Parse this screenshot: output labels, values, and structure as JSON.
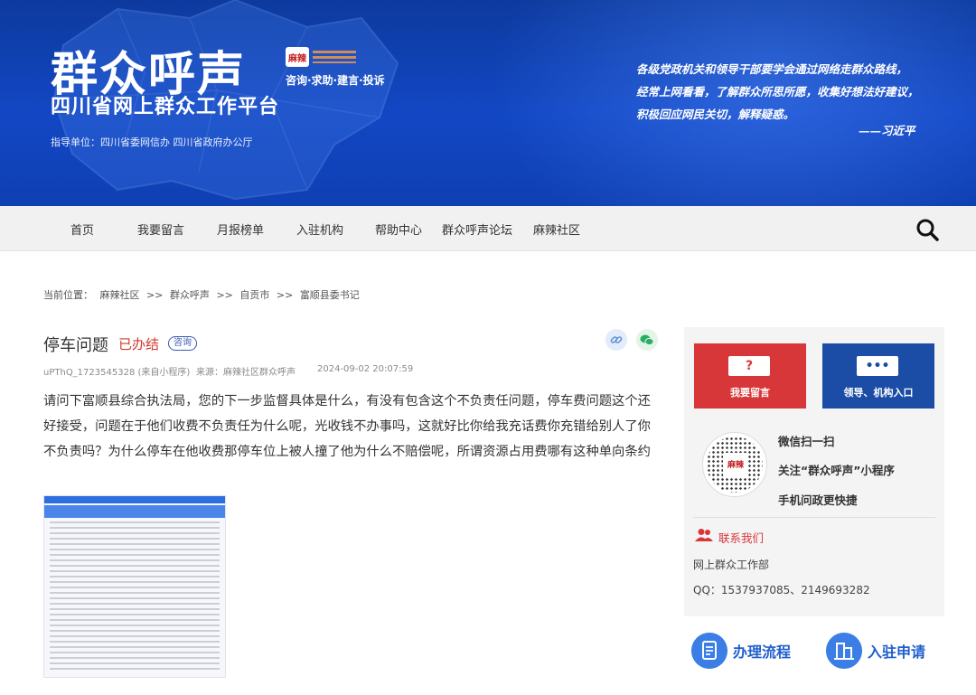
{
  "header": {
    "title": "群众呼声",
    "subtitle": "四川省网上群众工作平台",
    "guide": "指导单位：四川省委网信办 四川省政府办公厅",
    "mala_logo": "麻辣",
    "tags": "咨询·求助·建言·投诉",
    "quote_lines": [
      "各级党政机关和领导干部要学会通过网络走群众路线，",
      "经常上网看看，了解群众所思所愿，收集好想法好建议，",
      "积极回应网民关切，解释疑惑。"
    ],
    "quote_author": "——习近平"
  },
  "nav": {
    "items": [
      "首页",
      "我要留言",
      "月报榜单",
      "入驻机构",
      "帮助中心",
      "群众呼声论坛",
      "麻辣社区"
    ]
  },
  "breadcrumb": {
    "prefix": "当前位置：",
    "items": [
      "麻辣社区",
      "群众呼声",
      "自贡市",
      "富顺县委书记"
    ],
    "separator": ">>"
  },
  "article": {
    "title": "停车问题",
    "status": "已办结",
    "tag": "咨询",
    "author": "uPThQ_1723545328 (来自小程序)",
    "source": "来源：麻辣社区群众呼声",
    "time": "2024-09-02 20:07:59",
    "body": "请问下富顺县综合执法局，您的下一步监督具体是什么，有没有包含这个不负责任问题，停车费问题这个还好接受，问题在于他们收费不负责任为什么呢，光收钱不办事吗，这就好比你给我充话费你充错给别人了你不负责吗？为什么停车在他收费那停车位上被人撞了他为什么不赔偿呢，所谓资源占用费哪有这种单向条约"
  },
  "sidebar": {
    "leave_button": "我要留言",
    "leave_icon": "?",
    "org_button": "领导、机构入口",
    "org_icon": "•••",
    "qr_logo": "麻辣",
    "qr_lines": [
      "微信扫一扫",
      "关注“群众呼声”小程序",
      "手机问政更快捷"
    ],
    "contact_title": "联系我们",
    "contact_dept": "网上群众工作部",
    "contact_qq": "QQ：1537937085、2149693282"
  },
  "bottom": {
    "process": "办理流程",
    "apply": "入驻申请"
  },
  "colors": {
    "banner_blue": "#1247c4",
    "status_red": "#d23a2a",
    "leave_red": "#d8373a",
    "org_blue": "#1c4da6",
    "link_blue": "#1f5fcc"
  }
}
